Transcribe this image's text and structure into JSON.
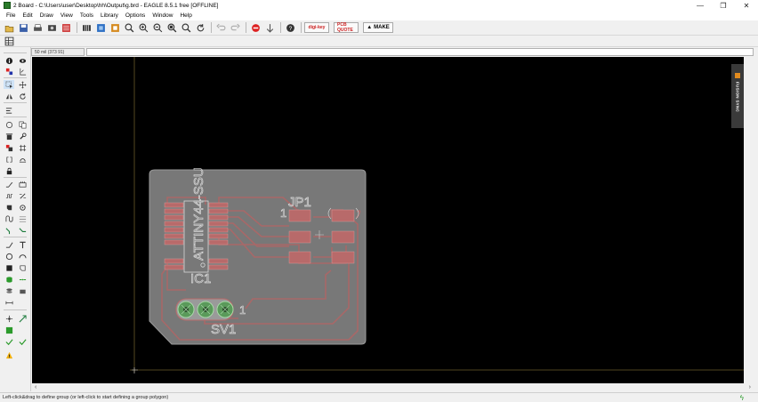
{
  "window": {
    "title": "2 Board - C:\\Users\\user\\Desktop\\hh\\Output\\g.brd - EAGLE 8.5.1 free [OFFLINE]",
    "minimize": "—",
    "restore": "❐",
    "close": "✕"
  },
  "menu": [
    "File",
    "Edit",
    "Draw",
    "View",
    "Tools",
    "Library",
    "Options",
    "Window",
    "Help"
  ],
  "toolbar": {
    "make_label": "MAKE",
    "digikey_label": "digi-key",
    "pcb_quote_label": "PCB QUOTE"
  },
  "command": {
    "grid_readout": "50 mil (373 91)",
    "input_value": ""
  },
  "board": {
    "labels": {
      "ic_name": "IC1",
      "ic_value": "ATTINY44-SSU",
      "jumper_name": "JP1",
      "jumper_pin1": "1",
      "header_name": "SV1",
      "header_pin1": "1"
    }
  },
  "fusion_sync": "FUSION SYNC",
  "status": {
    "message": "Left-click&drag to define group (or left-click to start defining a group polygon)"
  },
  "colors": {
    "canvas_bg": "#000000",
    "board_fill": "#787878",
    "pad_fill": "#b86a6a",
    "trace": "#a86868",
    "silk": "#d8d8d8",
    "via_fill": "#5a9a5a"
  }
}
